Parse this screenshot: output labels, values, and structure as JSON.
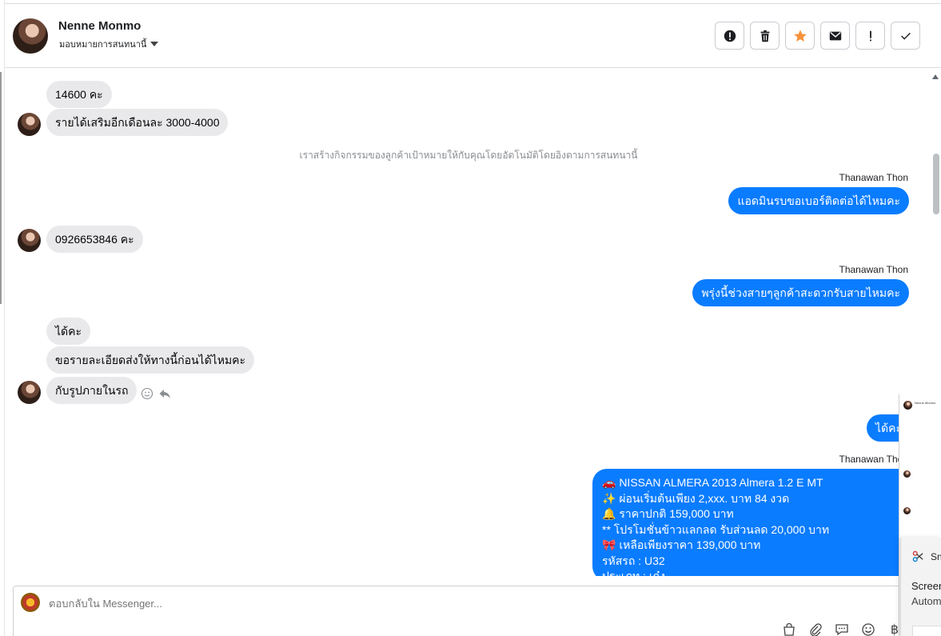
{
  "header": {
    "contact_name": "Nenne Monmo",
    "assign_label": "มอบหมายการสนทนานี้"
  },
  "actions": [
    {
      "name": "report-spam-button",
      "icon": "alert-circle-icon"
    },
    {
      "name": "delete-button",
      "icon": "trash-icon"
    },
    {
      "name": "star-button",
      "icon": "star-icon"
    },
    {
      "name": "mark-unread-button",
      "icon": "envelope-icon"
    },
    {
      "name": "follow-up-button",
      "icon": "exclamation-icon"
    },
    {
      "name": "mark-done-button",
      "icon": "check-icon"
    }
  ],
  "colors": {
    "outgoing": "#0a7cff",
    "incoming": "#e9e9eb",
    "star": "#f7923b"
  },
  "messages": {
    "m1": "14600 คะ",
    "m2": "รายได้เสริมอีกเดือนละ 3000-4000",
    "system_note": "เราสร้างกิจกรรมของลูกค้าเป้าหมายให้กับคุณโดยอัตโนมัติโดยอิงตามการสนทนานี้",
    "sender1": "Thanawan Thon",
    "m3": "แอดมินรบขอเบอร์ติดต่อได้ไหมคะ",
    "m4": "0926653846 คะ",
    "sender2": "Thanawan Thon",
    "m5": "พรุ่งนี้ช่วงสายๆลูกค้าสะดวกรับสายไหมคะ",
    "m6": "ได้คะ",
    "m7": "ขอรายละเอียดส่งให้ทางนี้ก่อนได้ไหมคะ",
    "m8": "กับรูปภายในรถ",
    "m9": "ได้คะ",
    "sender3": "Thanawan Thon",
    "listing": [
      "🚗  NISSAN ALMERA 2013 Almera 1.2 E MT",
      "✨  ผ่อนเริ่มต้นเพียง 2,xxx. บาท 84 งวด",
      "🔔  ราคาปกติ 159,000 บาท",
      "** โปรโมชั่นข้าวแลกลด รับส่วนลด 20,000 บาท",
      "🎀  เหลือเพียงราคา 139,000 บาท",
      "   รหัสรถ : U32",
      "   ประเภท : เก๋ง"
    ]
  },
  "composer": {
    "placeholder": "ตอบกลับใน Messenger..."
  },
  "tools": {
    "baht_symbol": "฿"
  },
  "overlay": {
    "mini_name": "Nenne Monmo",
    "snip_label": "Sn",
    "screen_label": "Screen",
    "auto_label": "Autom"
  }
}
